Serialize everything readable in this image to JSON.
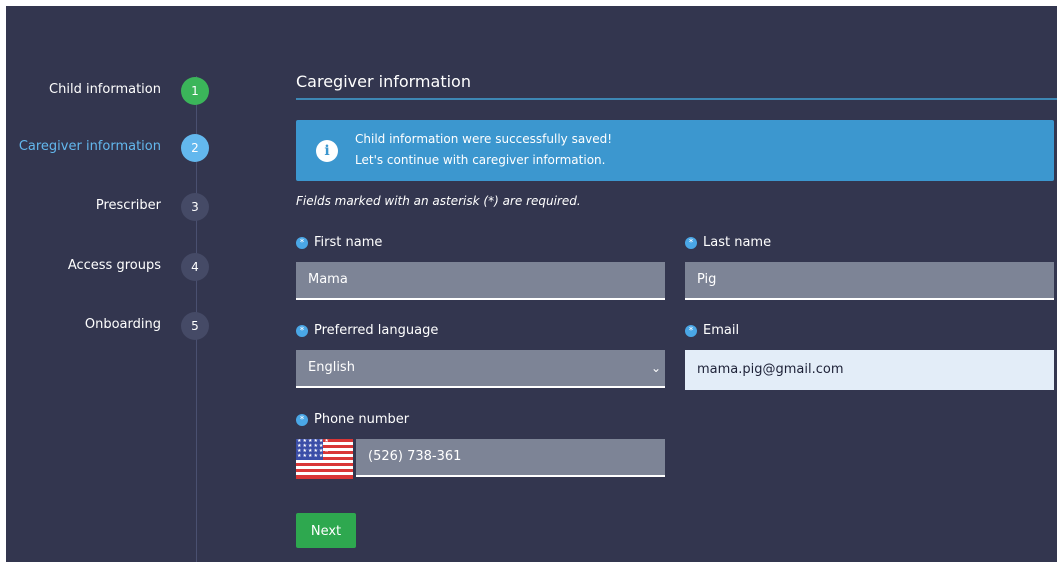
{
  "steps": [
    {
      "label": "Child information",
      "number": "1",
      "state": "done"
    },
    {
      "label": "Caregiver information",
      "number": "2",
      "state": "active"
    },
    {
      "label": "Prescriber",
      "number": "3",
      "state": "pending"
    },
    {
      "label": "Access groups",
      "number": "4",
      "state": "pending"
    },
    {
      "label": "Onboarding",
      "number": "5",
      "state": "pending"
    }
  ],
  "main": {
    "title": "Caregiver information",
    "alert": {
      "icon": "info-icon",
      "line1": "Child information were successfully saved!",
      "line2": "Let's continue with caregiver information."
    },
    "required_note": "Fields marked with an asterisk (*) are required.",
    "required_marker": "*"
  },
  "form": {
    "first_name": {
      "label": "First name",
      "value": "Mama"
    },
    "last_name": {
      "label": "Last name",
      "value": "Pig"
    },
    "language": {
      "label": "Preferred language",
      "value": "English"
    },
    "email": {
      "label": "Email",
      "value": "mama.pig@gmail.com"
    },
    "phone": {
      "label": "Phone number",
      "value": "(526) 738-361",
      "flag_icon": "us-flag-icon"
    }
  },
  "next_label": "Next",
  "colors": {
    "background": "#33364f",
    "accent": "#3c97cf",
    "success": "#3bb55a",
    "active_step": "#63b8ee"
  }
}
